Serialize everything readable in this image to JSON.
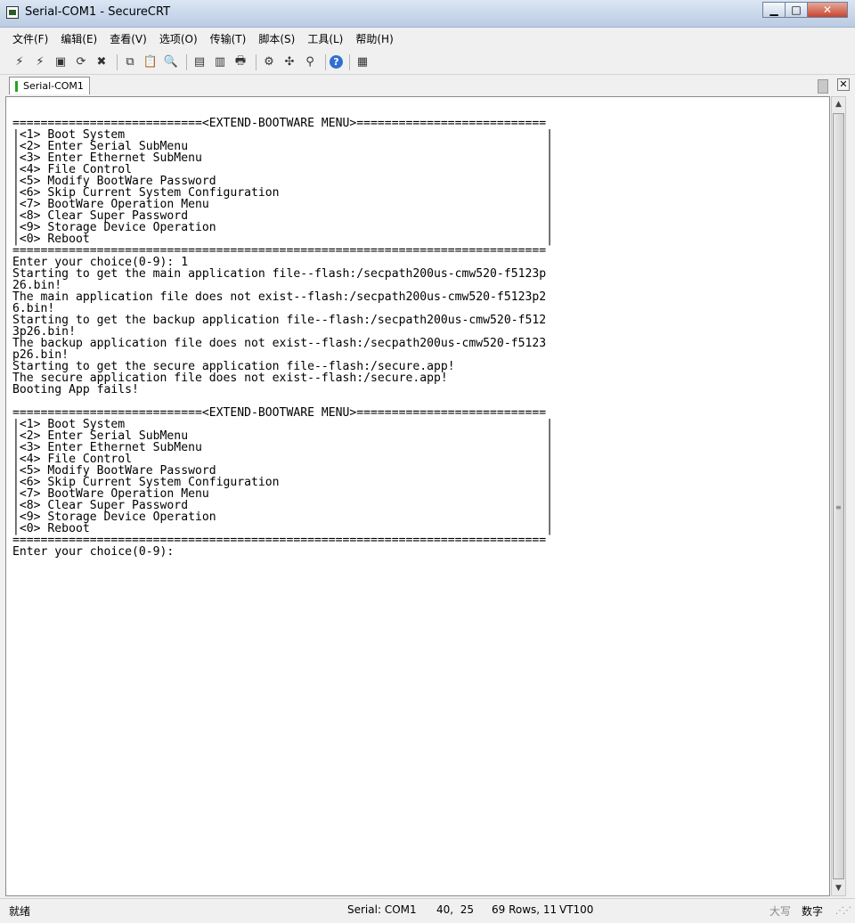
{
  "window": {
    "title": "Serial-COM1 - SecureCRT",
    "controls": {
      "minimize": "▁",
      "maximize": "□",
      "close": "✕"
    }
  },
  "menu": [
    "文件(F)",
    "编辑(E)",
    "查看(V)",
    "选项(O)",
    "传输(T)",
    "脚本(S)",
    "工具(L)",
    "帮助(H)"
  ],
  "toolbar": {
    "icons": [
      {
        "name": "connect-icon",
        "glyph": "⚡"
      },
      {
        "name": "quick-connect-icon",
        "glyph": "⚡"
      },
      {
        "name": "connect-in-tab-icon",
        "glyph": "▣"
      },
      {
        "name": "reconnect-icon",
        "glyph": "⟳"
      },
      {
        "name": "disconnect-icon",
        "glyph": "✖"
      },
      {
        "name": "copy-icon",
        "glyph": "⧉"
      },
      {
        "name": "paste-icon",
        "glyph": "📋"
      },
      {
        "name": "find-icon",
        "glyph": "🔍"
      },
      {
        "name": "print-setup-icon",
        "glyph": "▤"
      },
      {
        "name": "print-selection-icon",
        "glyph": "▥"
      },
      {
        "name": "print-icon",
        "glyph": "🖶"
      },
      {
        "name": "session-options-icon",
        "glyph": "⚙"
      },
      {
        "name": "global-options-icon",
        "glyph": "✣"
      },
      {
        "name": "keymap-icon",
        "glyph": "⚲"
      },
      {
        "name": "help-icon",
        "glyph": "?"
      },
      {
        "name": "sftp-icon",
        "glyph": "▦"
      }
    ]
  },
  "tabs": [
    {
      "label": "Serial-COM1"
    }
  ],
  "terminal": {
    "lines": [
      "===========================<EXTEND-BOOTWARE MENU>===========================",
      "|<1> Boot System                                                            |",
      "|<2> Enter Serial SubMenu                                                   |",
      "|<3> Enter Ethernet SubMenu                                                 |",
      "|<4> File Control                                                           |",
      "|<5> Modify BootWare Password                                               |",
      "|<6> Skip Current System Configuration                                      |",
      "|<7> BootWare Operation Menu                                                |",
      "|<8> Clear Super Password                                                   |",
      "|<9> Storage Device Operation                                               |",
      "|<0> Reboot                                                                 |",
      "============================================================================",
      "Enter your choice(0-9): 1",
      "Starting to get the main application file--flash:/secpath200us-cmw520-f5123p",
      "26.bin!",
      "The main application file does not exist--flash:/secpath200us-cmw520-f5123p2",
      "6.bin!",
      "Starting to get the backup application file--flash:/secpath200us-cmw520-f512",
      "3p26.bin!",
      "The backup application file does not exist--flash:/secpath200us-cmw520-f5123",
      "p26.bin!",
      "Starting to get the secure application file--flash:/secure.app!",
      "The secure application file does not exist--flash:/secure.app!",
      "Booting App fails!",
      "",
      "===========================<EXTEND-BOOTWARE MENU>===========================",
      "|<1> Boot System                                                            |",
      "|<2> Enter Serial SubMenu                                                   |",
      "|<3> Enter Ethernet SubMenu                                                 |",
      "|<4> File Control                                                           |",
      "|<5> Modify BootWare Password                                               |",
      "|<6> Skip Current System Configuration                                      |",
      "|<7> BootWare Operation Menu                                                |",
      "|<8> Clear Super Password                                                   |",
      "|<9> Storage Device Operation                                               |",
      "|<0> Reboot                                                                 |",
      "============================================================================",
      "Enter your choice(0-9):"
    ]
  },
  "status": {
    "ready": "就绪",
    "connection": "Serial: COM1",
    "cursor": "40,  25",
    "size": "69 Rows, 11",
    "emulation": "VT100",
    "caps": "大写",
    "num": "数字"
  }
}
